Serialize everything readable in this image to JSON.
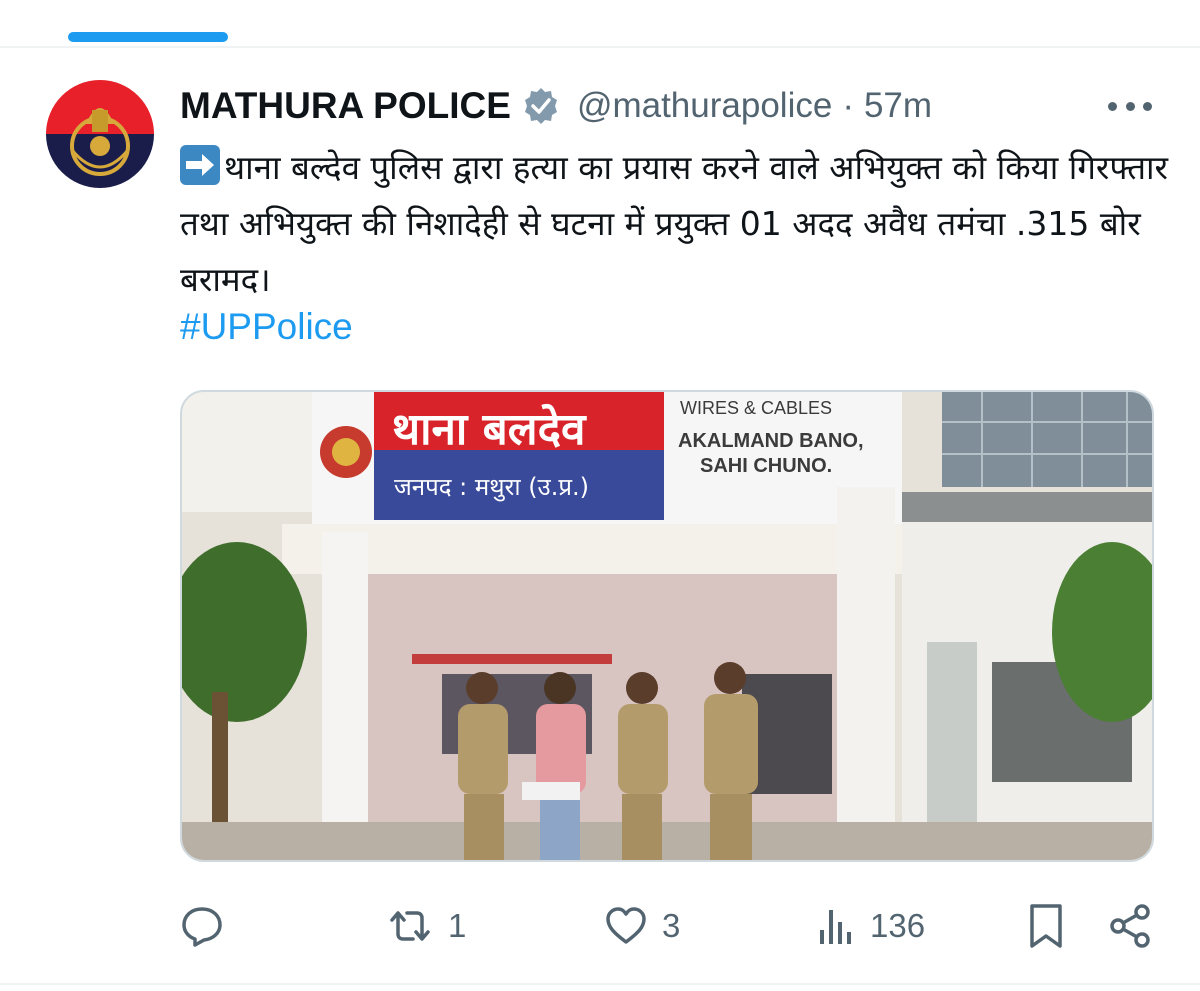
{
  "tweet": {
    "display_name": "MATHURA POLICE",
    "handle": "@mathurapolice",
    "separator": "·",
    "time": "57m",
    "text": "थाना बल्देव पुलिस द्वारा हत्या का प्रयास करने वाले अभियुक्त को किया गिरफ्तार तथा अभियुक्त की निशादेही से घटना में प्रयुक्त 01 अदद अवैध तमंचा .315 बोर बरामद।",
    "hashtag": "#UPPolice",
    "colors": {
      "accent": "#1d9bf0",
      "muted": "#536471",
      "text": "#0f1419"
    }
  },
  "media": {
    "sign_hindi_main": "थाना बलदेव",
    "sign_hindi_sub": "जनपद : मथुरा (उ.प्र.)",
    "ad_line1": "WIRES & CABLES",
    "ad_line2": "AKALMAND BANO,",
    "ad_line3": "SAHI CHUNO."
  },
  "actions": {
    "reply": {
      "icon": "reply-icon",
      "count": ""
    },
    "retweet": {
      "icon": "retweet-icon",
      "count": "1"
    },
    "like": {
      "icon": "heart-icon",
      "count": "3"
    },
    "views": {
      "icon": "views-icon",
      "count": "136"
    },
    "bookmark": {
      "icon": "bookmark-icon"
    },
    "share": {
      "icon": "share-icon"
    }
  }
}
